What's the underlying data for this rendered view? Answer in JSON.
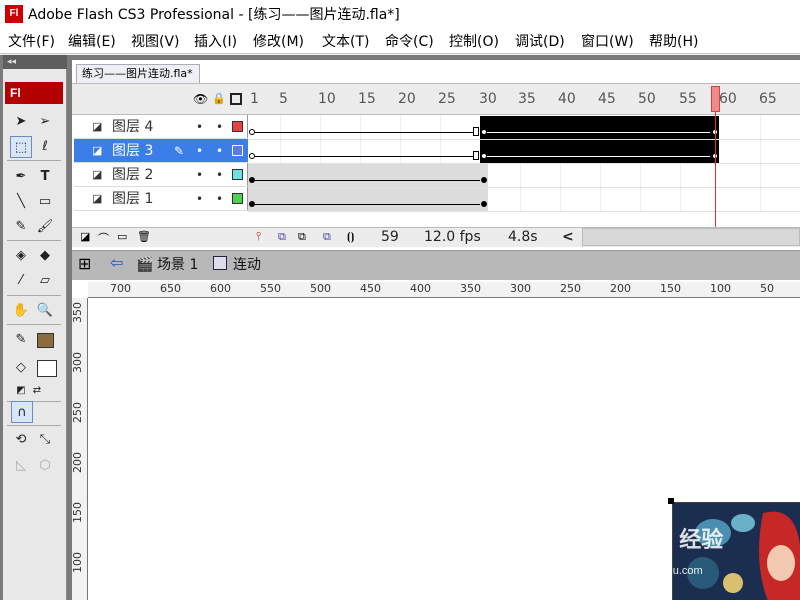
{
  "window": {
    "title": "Adobe Flash CS3 Professional - [练习——图片连动.fla*]",
    "app_icon": "Fl"
  },
  "menu": [
    "文件(F)",
    "编辑(E)",
    "视图(V)",
    "插入(I)",
    "修改(M)",
    "文本(T)",
    "命令(C)",
    "控制(O)",
    "调试(D)",
    "窗口(W)",
    "帮助(H)"
  ],
  "toolbox": {
    "collapse": "◂◂",
    "logo": "Fl"
  },
  "document_tab": "练习——图片连动.fla*",
  "timeline": {
    "frame_ruler": [
      "1",
      "5",
      "10",
      "15",
      "20",
      "25",
      "30",
      "35",
      "40",
      "45",
      "50",
      "55",
      "60",
      "65"
    ],
    "layers": [
      {
        "name": "图层 4",
        "color": "#e84040",
        "selected": false
      },
      {
        "name": "图层 3",
        "color": "#5a78f0",
        "selected": true
      },
      {
        "name": "图层 2",
        "color": "#70e0e0",
        "selected": false
      },
      {
        "name": "图层 1",
        "color": "#50d050",
        "selected": false
      }
    ],
    "current_frame": "59",
    "fps": "12.0 fps",
    "elapsed": "4.8s",
    "scroll_left": "<"
  },
  "edit_bar": {
    "back": "⇦",
    "scene": "场景 1",
    "symbol": "连动"
  },
  "stage": {
    "hruler": [
      "700",
      "650",
      "600",
      "550",
      "500",
      "450",
      "400",
      "350",
      "300",
      "250",
      "200",
      "150",
      "100",
      "50"
    ],
    "vruler": [
      "350",
      "300",
      "250",
      "200",
      "150",
      "100"
    ]
  },
  "watermark": {
    "line1": "Baidu 经验",
    "line2": "jingyan.baidu.com"
  }
}
